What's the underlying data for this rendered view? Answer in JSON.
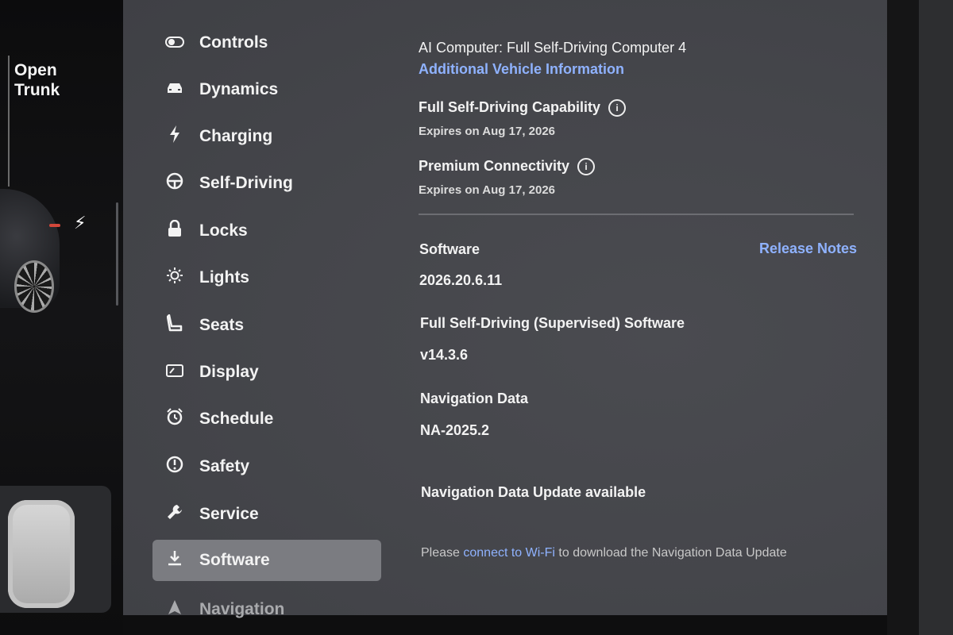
{
  "car": {
    "trunk_label_line1": "Open",
    "trunk_label_line2": "Trunk"
  },
  "sidebar": {
    "items": [
      {
        "label": "Controls",
        "icon": "toggle-icon"
      },
      {
        "label": "Dynamics",
        "icon": "car-icon"
      },
      {
        "label": "Charging",
        "icon": "bolt-icon"
      },
      {
        "label": "Self-Driving",
        "icon": "steering-wheel-icon"
      },
      {
        "label": "Locks",
        "icon": "lock-icon"
      },
      {
        "label": "Lights",
        "icon": "sun-icon"
      },
      {
        "label": "Seats",
        "icon": "seat-icon"
      },
      {
        "label": "Display",
        "icon": "display-icon"
      },
      {
        "label": "Schedule",
        "icon": "alarm-icon"
      },
      {
        "label": "Safety",
        "icon": "alert-icon"
      },
      {
        "label": "Service",
        "icon": "wrench-icon"
      },
      {
        "label": "Software",
        "icon": "download-icon",
        "active": true
      },
      {
        "label": "Navigation",
        "icon": "navigation-icon"
      }
    ]
  },
  "info": {
    "ai_computer": "AI Computer: Full Self-Driving Computer 4",
    "additional_info_link": "Additional Vehicle Information",
    "fsd_capability_title": "Full Self-Driving Capability",
    "fsd_capability_expiry": "Expires on Aug 17, 2026",
    "premium_title": "Premium Connectivity",
    "premium_expiry": "Expires on Aug 17, 2026"
  },
  "software": {
    "title": "Software",
    "release_notes_link": "Release Notes",
    "version": "2026.20.6.11",
    "fsd_software_title": "Full Self-Driving (Supervised) Software",
    "fsd_software_version": "v14.3.6",
    "nav_data_title": "Navigation Data",
    "nav_data_version": "NA-2025.2",
    "nav_update_title": "Navigation Data Update available",
    "nav_update_note_prefix": "Please ",
    "nav_update_note_link": "connect to Wi-Fi",
    "nav_update_note_suffix": " to download the Navigation Data Update"
  },
  "colors": {
    "accent_link": "#8fb2ff",
    "panel_bg": "#45464b",
    "active_item_bg": "#7b7c81"
  }
}
